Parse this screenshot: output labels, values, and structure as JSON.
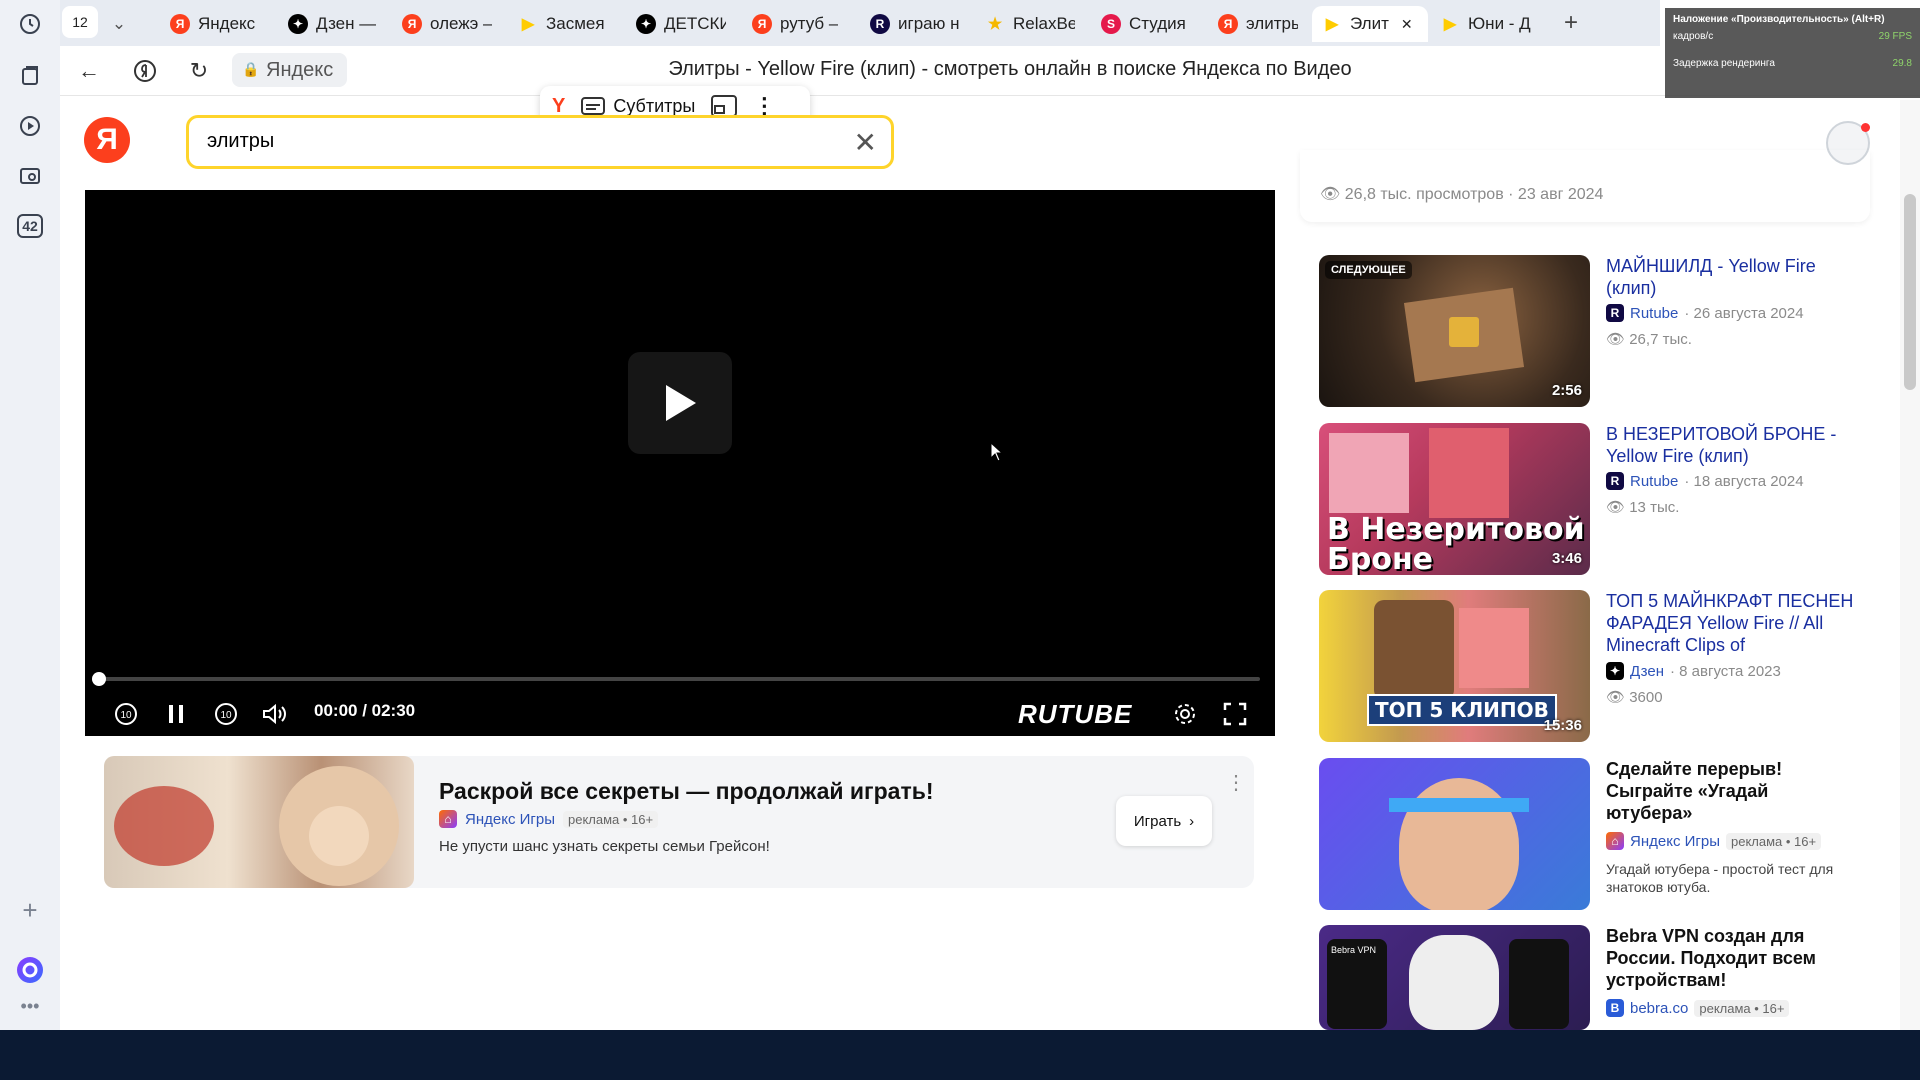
{
  "browser": {
    "tab_count": "12",
    "tabs": [
      {
        "label": "Яндекс",
        "icon": "yandex-icon",
        "color": "#fc3f1d"
      },
      {
        "label": "Дзен —",
        "icon": "dzen-icon",
        "color": "#000000"
      },
      {
        "label": "олежэ –",
        "icon": "yandex-icon",
        "color": "#fc3f1d"
      },
      {
        "label": "Засмея",
        "icon": "video-play-icon",
        "color": "#ffcc00"
      },
      {
        "label": "ДЕТСКИ",
        "icon": "dzen-icon",
        "color": "#000000"
      },
      {
        "label": "рутуб –",
        "icon": "yandex-icon",
        "color": "#fc3f1d"
      },
      {
        "label": "играю н",
        "icon": "rutube-icon",
        "color": "#100943"
      },
      {
        "label": "RelaxBe",
        "icon": "star-icon",
        "color": "#f5b800"
      },
      {
        "label": "Студия",
        "icon": "studio-icon",
        "color": "#e5194b"
      },
      {
        "label": "элитры",
        "icon": "yandex-icon",
        "color": "#fc3f1d"
      },
      {
        "label": "Элит",
        "icon": "video-play-icon",
        "color": "#ffcc00",
        "active": true
      },
      {
        "label": "Юни - Д",
        "icon": "video-play-icon",
        "color": "#ffcc00"
      }
    ],
    "site_chip": "Яндекс",
    "page_title": "Элитры - Yellow Fire (клип) - смотреть онлайн в поиске Яндекса по Видео",
    "sidebar_badge": "42"
  },
  "perf_overlay": {
    "title": "Наложение «Производительность» (Alt+R)",
    "line1": "кадров/с",
    "line2": "Задержка рендеринга",
    "fps": "29 FPS",
    "latency": "29.8"
  },
  "float_tools": {
    "subtitles_label": "Субтитры"
  },
  "search": {
    "query": "элитры"
  },
  "player": {
    "time": "00:00 / 02:30",
    "brand": "RUTUBE",
    "progress": 0.0
  },
  "ad": {
    "title": "Раскрой все секреты — продолжай играть!",
    "source": "Яндекс Игры",
    "tag": "реклама • 16+",
    "description": "Не упусти шанс узнать секреты семьи Грейсон!",
    "button": "Играть"
  },
  "related": {
    "prev_meta": "26,8 тыс. просмотров  ·  23 авг 2024",
    "next_badge": "СЛЕДУЮЩЕЕ",
    "items": [
      {
        "title": "МАЙНШИЛД - Yellow Fire (клип)",
        "channel": "Rutube",
        "date": "· 26 августа 2024",
        "views": "26,7 тыс.",
        "duration": "2:56"
      },
      {
        "title": "В НЕЗЕРИТОВОЙ БРОНЕ - Yellow Fire (клип)",
        "channel": "Rutube",
        "date": "· 18 августа 2024",
        "views": "13 тыс.",
        "duration": "3:46",
        "thumb_text": "В Незеритовой Броне"
      },
      {
        "title": "ТОП 5 МАЙНКРАФТ ПЕСНЕН ФАРАДЕЯ Yellow Fire // All Minecraft Clips of",
        "channel": "Дзен",
        "date": "· 8 августа 2023",
        "views": "3600",
        "duration": "15:36",
        "thumb_text": "ТОП 5 КЛИПОВ"
      },
      {
        "title": "Сделайте перерыв! Сыграйте «Угадай ютубера»",
        "channel": "Яндекс Игры",
        "tag": "реклама • 16+",
        "desc": "Угадай ютубера - простой тест для знатоков ютуба."
      },
      {
        "title": "Bebra VPN создан для России. Подходит всем устройствам!",
        "channel": "bebra.co",
        "tag": "реклама • 16+",
        "thumb_text": "Bebra VPN"
      }
    ]
  }
}
